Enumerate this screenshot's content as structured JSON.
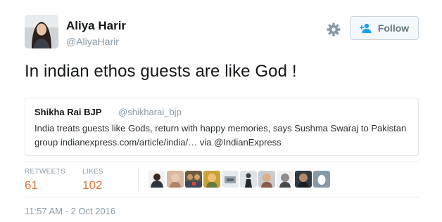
{
  "author": {
    "name": "Aliya Harir",
    "handle": "@AliyaHarir"
  },
  "actions": {
    "follow_label": "Follow",
    "gear_icon": "gear-icon",
    "follow_icon": "follow-person-plus-icon"
  },
  "tweet": {
    "text": "In indian ethos guests are like God !"
  },
  "quoted_tweet": {
    "name": "Shikha Rai BJP",
    "handle": "@shikharai_bjp",
    "text": "India treats guests like Gods, return with happy memories, says Sushma Swaraj to Pakistan group indianexpress.com/article/india/… via @IndianExpress"
  },
  "stats": {
    "retweets_label": "RETWEETS",
    "retweets_value": "61",
    "likes_label": "LIKES",
    "likes_value": "102"
  },
  "timestamp": "11:57 AM - 2 Oct 2016",
  "colors": {
    "accent_count": "#e0783b",
    "muted_text": "#8899a6",
    "border": "#e1e8ed"
  }
}
